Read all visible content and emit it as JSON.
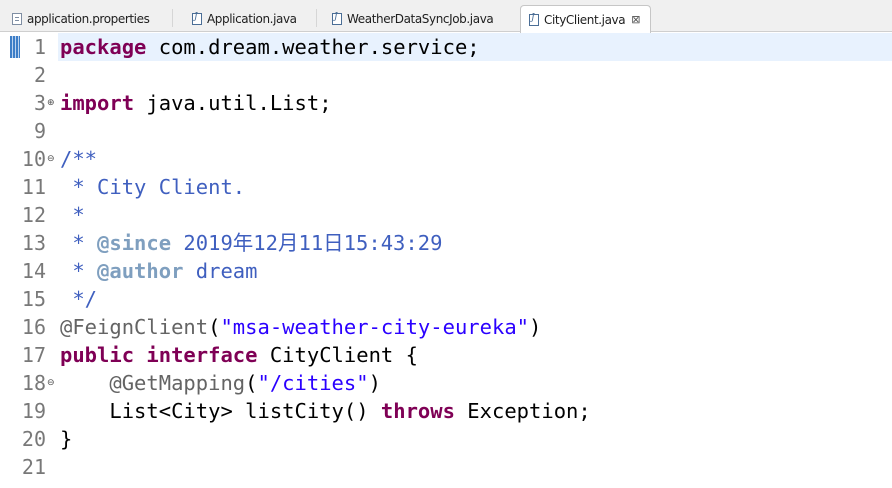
{
  "tabs": [
    {
      "label": "application.properties",
      "icon": "properties-file-icon",
      "active": false
    },
    {
      "label": "Application.java",
      "icon": "java-file-icon",
      "active": false
    },
    {
      "label": "WeatherDataSyncJob.java",
      "icon": "java-file-icon",
      "active": false
    },
    {
      "label": "CityClient.java",
      "icon": "java-file-icon",
      "active": true,
      "close": "⊠"
    }
  ],
  "editor": {
    "lines": [
      {
        "num": "1",
        "fold": "",
        "segments": [
          [
            "kw",
            "package"
          ],
          [
            "id",
            " com.dream.weather.service;"
          ]
        ]
      },
      {
        "num": "2",
        "fold": "",
        "segments": []
      },
      {
        "num": "3",
        "fold": "⊕",
        "segments": [
          [
            "kw",
            "import"
          ],
          [
            "id",
            " java.util.List;"
          ]
        ]
      },
      {
        "num": "9",
        "fold": "",
        "segments": []
      },
      {
        "num": "10",
        "fold": "⊖",
        "segments": [
          [
            "cm",
            "/**"
          ]
        ]
      },
      {
        "num": "11",
        "fold": "",
        "segments": [
          [
            "cm",
            " * City Client."
          ]
        ]
      },
      {
        "num": "12",
        "fold": "",
        "segments": [
          [
            "cm",
            " *"
          ]
        ]
      },
      {
        "num": "13",
        "fold": "",
        "segments": [
          [
            "cm",
            " * "
          ],
          [
            "tag",
            "@since"
          ],
          [
            "cm",
            " 2019年12月11日15:43:29"
          ]
        ]
      },
      {
        "num": "14",
        "fold": "",
        "segments": [
          [
            "cm",
            " * "
          ],
          [
            "tag",
            "@author"
          ],
          [
            "cm",
            " dream"
          ]
        ]
      },
      {
        "num": "15",
        "fold": "",
        "segments": [
          [
            "cm",
            " */"
          ]
        ]
      },
      {
        "num": "16",
        "fold": "",
        "segments": [
          [
            "an",
            "@FeignClient"
          ],
          [
            "id",
            "("
          ],
          [
            "st",
            "\"msa-weather-city-eureka\""
          ],
          [
            "id",
            ")"
          ]
        ]
      },
      {
        "num": "17",
        "fold": "",
        "segments": [
          [
            "kw",
            "public"
          ],
          [
            "id",
            " "
          ],
          [
            "kw",
            "interface"
          ],
          [
            "id",
            " CityClient {"
          ]
        ]
      },
      {
        "num": "18",
        "fold": "⊖",
        "segments": [
          [
            "id",
            "    "
          ],
          [
            "an",
            "@GetMapping"
          ],
          [
            "id",
            "("
          ],
          [
            "st",
            "\"/cities\""
          ],
          [
            "id",
            ")"
          ]
        ]
      },
      {
        "num": "19",
        "fold": "",
        "segments": [
          [
            "id",
            "    List<City> listCity() "
          ],
          [
            "kw",
            "throws"
          ],
          [
            "id",
            " Exception;"
          ]
        ]
      },
      {
        "num": "20",
        "fold": "",
        "segments": [
          [
            "id",
            "}"
          ]
        ]
      },
      {
        "num": "21",
        "fold": "",
        "segments": []
      }
    ]
  }
}
